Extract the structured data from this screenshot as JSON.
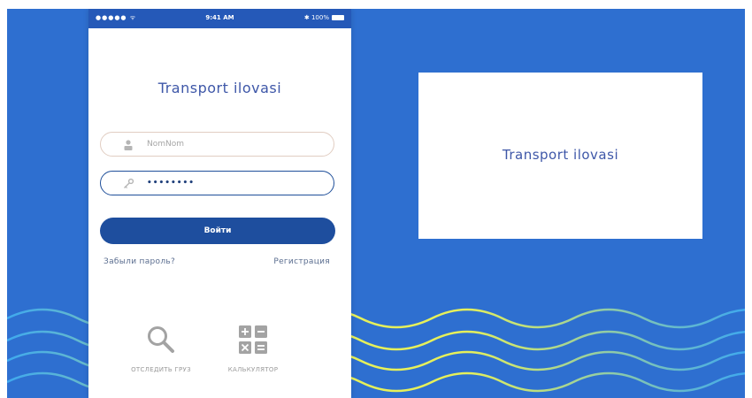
{
  "colors": {
    "background_blue": "#2e6fd0",
    "primary_button": "#1e4e9e",
    "title_text": "#3e57a8",
    "wave_blue": "#3fa9ee",
    "wave_yellow": "#e6f05a"
  },
  "status_bar": {
    "signal": "●●●●● ᯤ",
    "time": "9:41 AM",
    "battery": "✱ 100%"
  },
  "app": {
    "title": "Transport ilovasi"
  },
  "login": {
    "username_placeholder": "NomNom",
    "password_value": "••••••••",
    "login_button": "Войти",
    "forgot_password": "Забыли пароль?",
    "register": "Регистрация"
  },
  "shortcuts": [
    {
      "label": "ОТСЛЕДИТЬ ГРУЗ",
      "icon": "search-icon"
    },
    {
      "label": "КАЛЬКУЛЯТОР",
      "icon": "calculator-icon"
    }
  ],
  "card": {
    "title": "Transport ilovasi"
  }
}
